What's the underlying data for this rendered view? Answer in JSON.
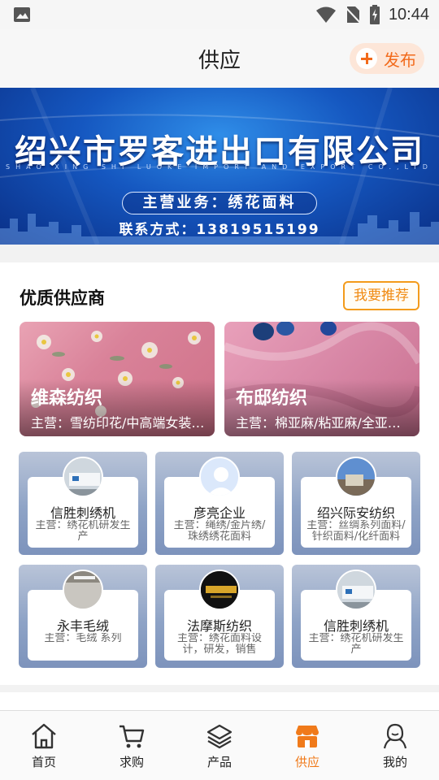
{
  "status_bar": {
    "time": "10:44"
  },
  "header": {
    "title": "供应",
    "publish_label": "发布"
  },
  "banner": {
    "company": "绍兴市罗客进出口有限公司",
    "company_en": "SHAO XING SHI LUOKE IMPORT AND EXPORT CO.,LTD",
    "business": "主营业务：绣花面料",
    "contact": "联系方式：13819515199"
  },
  "section": {
    "title": "优质供应商",
    "recommend_label": "我要推荐"
  },
  "featured": [
    {
      "name": "维森纺织",
      "desc": "主营：雪纺印花/中高端女装面料"
    },
    {
      "name": "布邸纺织",
      "desc": "主营：棉亚麻/粘亚麻/全亚麻面料"
    }
  ],
  "suppliers": [
    {
      "name": "信胜刺绣机",
      "desc": "主营：绣花机研发生产",
      "avatar": "building-photo"
    },
    {
      "name": "彦亮企业",
      "desc": "主营：绳绣/金片绣/珠绣绣花面料",
      "avatar": "default-user"
    },
    {
      "name": "绍兴际安纺织",
      "desc": "主营：丝绸系列面料/针织面料/化纤面料",
      "avatar": "building-photo"
    },
    {
      "name": "永丰毛绒",
      "desc": "主营：毛绒 系列",
      "avatar": "storefront-photo"
    },
    {
      "name": "法摩斯纺织",
      "desc": "主营：绣花面料设计，研发，销售",
      "avatar": "famous-logo"
    },
    {
      "name": "信胜刺绣机",
      "desc": "主营：绣花机研发生产",
      "avatar": "building-photo"
    }
  ],
  "tabs": [
    {
      "label": "首页",
      "icon": "home-icon"
    },
    {
      "label": "求购",
      "icon": "cart-icon"
    },
    {
      "label": "产品",
      "icon": "layers-icon"
    },
    {
      "label": "供应",
      "icon": "shop-icon",
      "active": true
    },
    {
      "label": "我的",
      "icon": "user-icon"
    }
  ],
  "colors": {
    "accent": "#f07a1a",
    "recommend_border": "#f39b1b",
    "banner_blue": "#1557c0"
  }
}
